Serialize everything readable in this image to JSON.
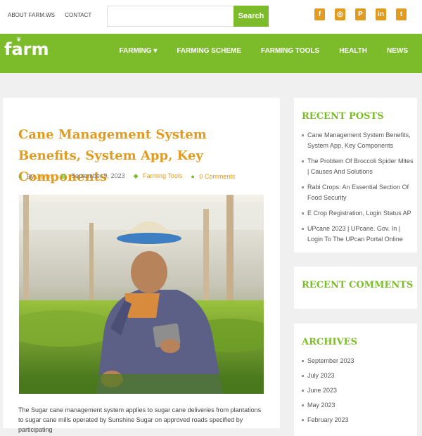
{
  "topbar": {
    "links": [
      "ABOUT FARM.WS",
      "CONTACT"
    ],
    "search": {
      "placeholder": "",
      "button_label": "Search"
    },
    "social_icons": [
      "facebook-icon",
      "instagram-icon",
      "pinterest-icon",
      "linkedin-icon",
      "twitter-icon"
    ]
  },
  "nav": {
    "logo": "farm",
    "menu": [
      "FARMING ▾",
      "FARMING SCHEME",
      "FARMING TOOLS",
      "HEALTH",
      "NEWS"
    ]
  },
  "post": {
    "title": "Cane Management System Benefits, System App, Key Components",
    "author_prefix": "By",
    "author": "Jaylin",
    "date": "September 9, 2023",
    "category": "Farming Tools",
    "comments": "0 Comments",
    "paragraph": "The Sugar cane management system applies to sugar cane deliveries from plantations to sugar cane mills operated by Sunshine Sugar on approved roads specified by participating"
  },
  "sidebar": {
    "recent_posts": {
      "title": "RECENT POSTS",
      "items": [
        "Cane Management System Benefits, System App, Key Components",
        "The Problem Of Broccoli Spider Mites | Causes And Solutions",
        "Rabi Crops: An Essential Section Of Food Security",
        "E Crop Registration, Login Status AP",
        "UPcane 2023 | UPcane. Gov. In | Login To The UPcan Portal Online"
      ]
    },
    "recent_comments": {
      "title": "RECENT COMMENTS"
    },
    "archives": {
      "title": "ARCHIVES",
      "items": [
        "September 2023",
        "July 2023",
        "June 2023",
        "May 2023",
        "February 2023"
      ]
    }
  },
  "colors": {
    "green": "#7cbc2a",
    "orange": "#e19b1e"
  }
}
